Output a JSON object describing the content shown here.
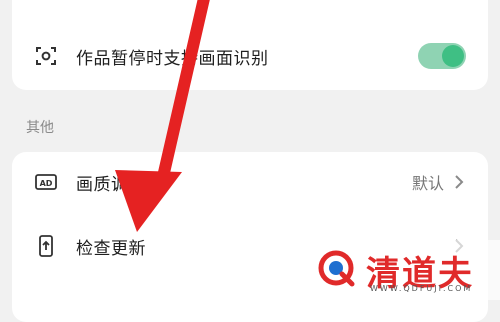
{
  "top_card": {
    "row": {
      "icon": "scan-icon",
      "label": "作品暂停时支持画面识别",
      "toggle_on": true
    }
  },
  "section": {
    "title": "其他"
  },
  "bottom_card": {
    "rows": [
      {
        "icon": "ad-icon",
        "label": "画质调节",
        "value": "默认"
      },
      {
        "icon": "phone-update-icon",
        "label": "检查更新"
      }
    ]
  },
  "watermark": {
    "brand": "清道夫",
    "url": "WWW.QDFUJI.COM"
  },
  "colors": {
    "accent": "#3fbf84",
    "arrow": "#e52222",
    "brand": "#e02a2a"
  }
}
